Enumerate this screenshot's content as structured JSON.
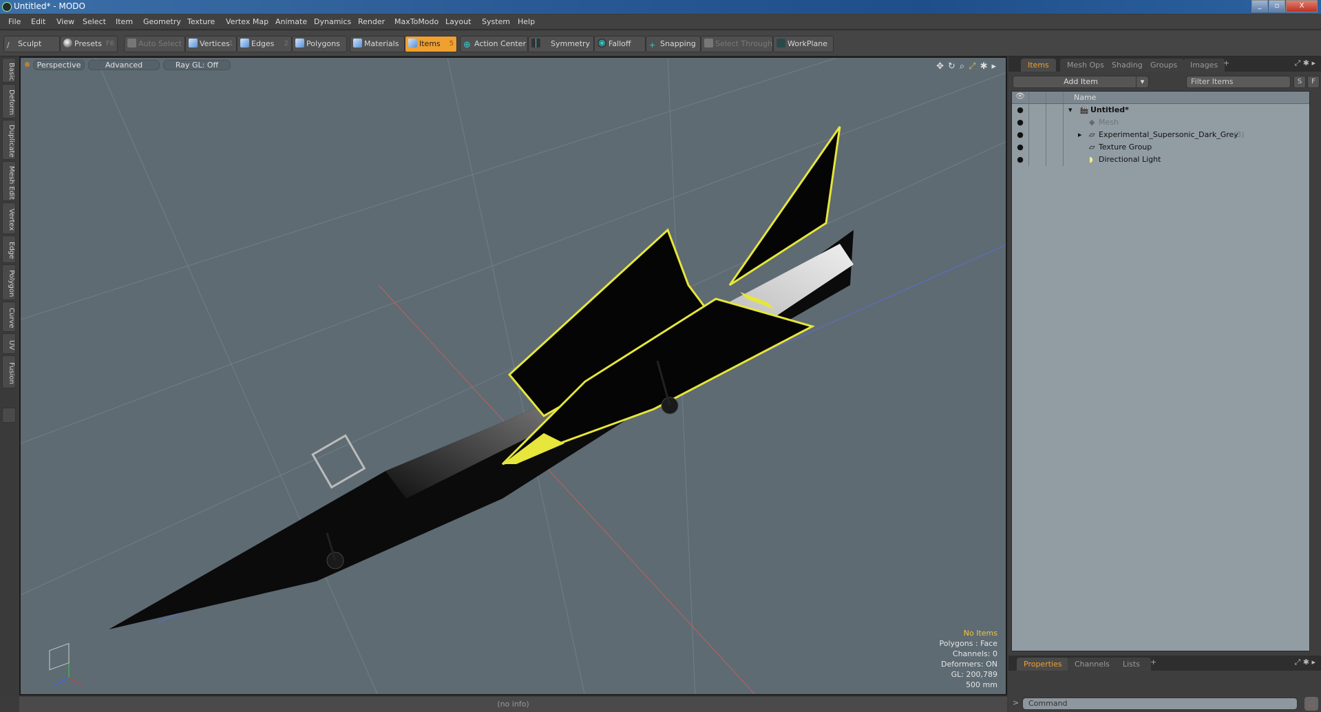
{
  "window": {
    "title": "Untitled* - MODO",
    "min": "_",
    "restore": "▫",
    "close": "X"
  },
  "menu": [
    "File",
    "Edit",
    "View",
    "Select",
    "Item",
    "Geometry",
    "Texture",
    "Vertex Map",
    "Animate",
    "Dynamics",
    "Render",
    "MaxToModo",
    "Layout",
    "System",
    "Help"
  ],
  "toolbar": {
    "sculpt": "Sculpt",
    "presets": "Presets",
    "presets_key": "F6",
    "auto_select": "Auto Select",
    "vertices": "Vertices",
    "vertices_key": "1",
    "edges": "Edges",
    "edges_key": "2",
    "polygons": "Polygons",
    "materials": "Materials",
    "items": "Items",
    "items_key": "5",
    "action_center": "Action Center",
    "symmetry": "Symmetry",
    "falloff": "Falloff",
    "snapping": "Snapping",
    "select_through": "Select Through",
    "workplane": "WorkPlane"
  },
  "left_tabs": [
    "Basic",
    "Deform",
    "Duplicate",
    "Mesh Edit",
    "Vertex",
    "Edge",
    "Polygon",
    "Curve",
    "UV",
    "Fusion"
  ],
  "viewport": {
    "view": "Perspective",
    "shading": "Advanced",
    "raygl": "Ray GL: Off",
    "hud": {
      "selection": "No Items",
      "polygons": "Polygons : Face",
      "channels": "Channels: 0",
      "deformers": "Deformers: ON",
      "gl": "GL: 200,789",
      "scale": "500 mm"
    },
    "colors": {
      "background": "#5e6b73",
      "accent": "#f0a030"
    }
  },
  "status": "(no info)",
  "items_panel": {
    "tabs": [
      "Items",
      "Mesh Ops",
      "Shading",
      "Groups",
      "Images"
    ],
    "add_item": "Add Item",
    "filter_placeholder": "Filter Items",
    "s_btn": "S",
    "f_btn": "F",
    "column_name": "Name",
    "tree": [
      {
        "label": "Untitled*",
        "level": 0,
        "type": "scene"
      },
      {
        "label": "Mesh",
        "level": 1,
        "type": "mesh"
      },
      {
        "label": "Experimental_Supersonic_Dark_Grey",
        "count": "(3)",
        "level": 1,
        "type": "group"
      },
      {
        "label": "Texture Group",
        "level": 1,
        "type": "group"
      },
      {
        "label": "Directional Light",
        "level": 1,
        "type": "light"
      }
    ]
  },
  "properties_panel": {
    "tabs": [
      "Properties",
      "Channels",
      "Lists"
    ]
  },
  "command": {
    "placeholder": "Command",
    "prompt": ">"
  }
}
